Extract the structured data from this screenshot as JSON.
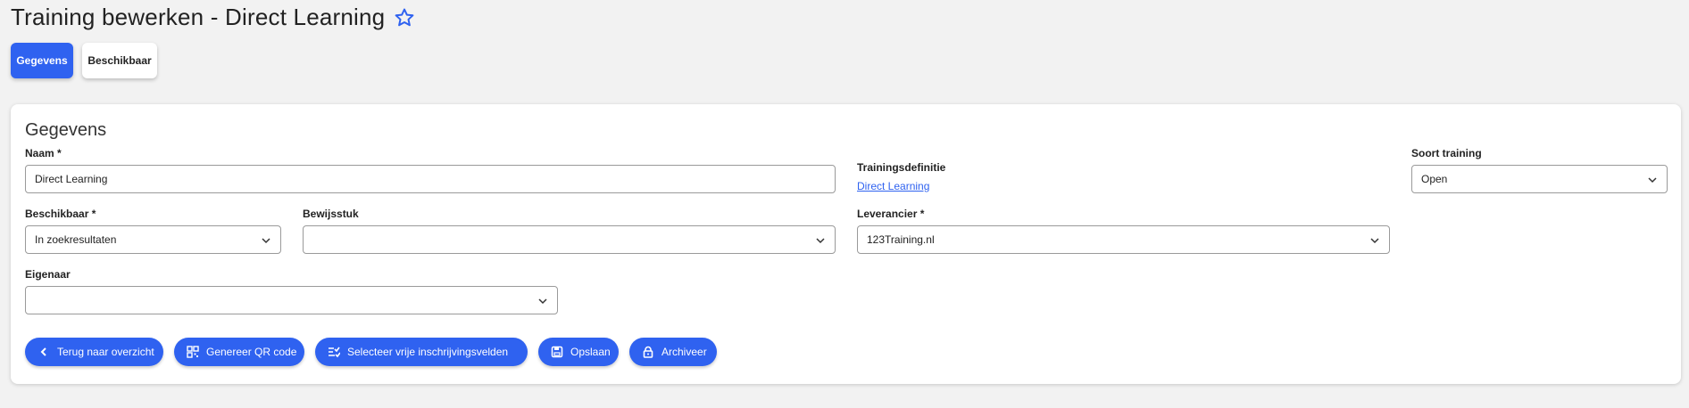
{
  "page": {
    "title": "Training bewerken - Direct Learning"
  },
  "tabs": [
    {
      "label": "Gegevens",
      "active": true
    },
    {
      "label": "Beschikbaar",
      "active": false
    }
  ],
  "card": {
    "title": "Gegevens",
    "fields": {
      "naam": {
        "label": "Naam *",
        "value": "Direct Learning"
      },
      "trainingsdefinitie": {
        "label": "Trainingsdefinitie",
        "link": "Direct Learning"
      },
      "soort_training": {
        "label": "Soort training",
        "value": "Open"
      },
      "beschikbaar": {
        "label": "Beschikbaar *",
        "value": "In zoekresultaten"
      },
      "bewijsstuk": {
        "label": "Bewijsstuk",
        "value": ""
      },
      "leverancier": {
        "label": "Leverancier *",
        "value": "123Training.nl"
      },
      "eigenaar": {
        "label": "Eigenaar",
        "value": ""
      }
    },
    "buttons": [
      {
        "label": "Terug naar overzicht",
        "icon": "chevron-left-icon"
      },
      {
        "label": "Genereer QR code",
        "icon": "qr-code-icon"
      },
      {
        "label": "Selecteer vrije inschrijvingsvelden",
        "icon": "checklist-icon"
      },
      {
        "label": "Opslaan",
        "icon": "save-icon"
      },
      {
        "label": "Archiveer",
        "icon": "lock-icon"
      }
    ]
  },
  "colors": {
    "primary": "#2f62f0",
    "background": "#f2f2f2",
    "card": "#ffffff"
  }
}
